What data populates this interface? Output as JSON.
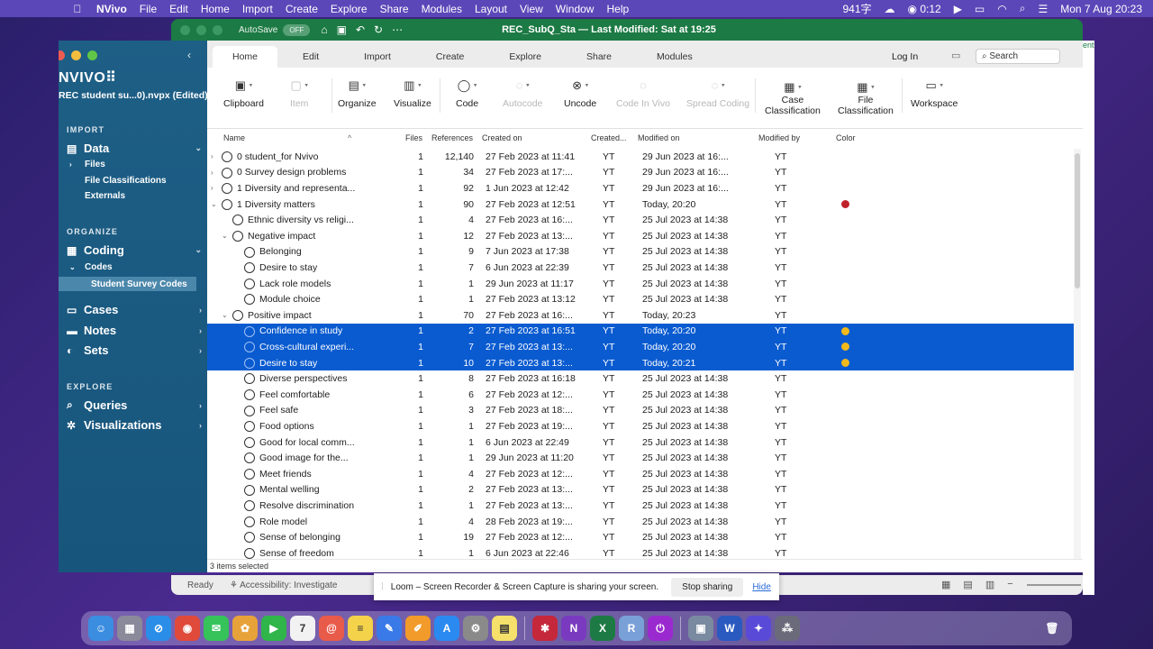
{
  "menubar": {
    "apple": "",
    "items": [
      "NVivo",
      "File",
      "Edit",
      "Home",
      "Import",
      "Create",
      "Explore",
      "Share",
      "Modules",
      "Layout",
      "View",
      "Window",
      "Help"
    ],
    "status_ime": "941字",
    "status_timer": "0:12",
    "datetime": "Mon 7 Aug  20:23"
  },
  "excel": {
    "autosave_label": "AutoSave",
    "autosave_state": "OFF",
    "title": "REC_SubQ_Sta — Last Modified: Sat at 19:25",
    "side_text": "ent",
    "status_ready": "Ready",
    "status_accessibility": "Accessibility: Investigate"
  },
  "sidebar": {
    "logo": "NVIVO",
    "logo_mark": "⠿",
    "project": "REC student su...0).nvpx (Edited)",
    "sections": {
      "import": "IMPORT",
      "organize": "ORGANIZE",
      "explore": "EXPLORE"
    },
    "data": "Data",
    "files": "Files",
    "file_classifications": "File Classifications",
    "externals": "Externals",
    "coding": "Coding",
    "codes": "Codes",
    "student_survey_codes": "Student Survey Codes",
    "cases": "Cases",
    "notes": "Notes",
    "sets": "Sets",
    "queries": "Queries",
    "visualizations": "Visualizations"
  },
  "tabs": {
    "home": "Home",
    "edit": "Edit",
    "import": "Import",
    "create": "Create",
    "explore": "Explore",
    "share": "Share",
    "modules": "Modules",
    "login": "Log In",
    "search_placeholder": "Search"
  },
  "ribbon": {
    "clipboard": "Clipboard",
    "item": "Item",
    "organize": "Organize",
    "visualize": "Visualize",
    "code": "Code",
    "autocode": "Autocode",
    "uncode": "Uncode",
    "code_in_vivo": "Code In Vivo",
    "spread_coding": "Spread Coding",
    "case_classification_1": "Case",
    "case_classification_2": "Classification",
    "file_classification_1": "File",
    "file_classification_2": "Classification",
    "workspace": "Workspace"
  },
  "columns": {
    "name": "Name",
    "files": "Files",
    "references": "References",
    "created_on": "Created on",
    "created_by": "Created...",
    "modified_on": "Modified on",
    "modified_by": "Modified by",
    "color": "Color"
  },
  "rows": [
    {
      "name": "0 student_for Nvivo",
      "files": "1",
      "refs": "12,140",
      "created": "27 Feb 2023 at 11:41",
      "by": "YT",
      "modified": "29 Jun 2023 at 16:...",
      "mby": "YT",
      "twisty": "›",
      "indent": 0,
      "color": "",
      "selected": false
    },
    {
      "name": "0 Survey design problems",
      "files": "1",
      "refs": "34",
      "created": "27 Feb 2023 at 17:...",
      "by": "YT",
      "modified": "29 Jun 2023 at 16:...",
      "mby": "YT",
      "twisty": "›",
      "indent": 0,
      "color": "",
      "selected": false
    },
    {
      "name": "1 Diversity and representa...",
      "files": "1",
      "refs": "92",
      "created": "1 Jun 2023 at 12:42",
      "by": "YT",
      "modified": "29 Jun 2023 at 16:...",
      "mby": "YT",
      "twisty": "›",
      "indent": 0,
      "color": "",
      "selected": false
    },
    {
      "name": "1 Diversity matters",
      "files": "1",
      "refs": "90",
      "created": "27 Feb 2023 at 12:51",
      "by": "YT",
      "modified": "Today, 20:20",
      "mby": "YT",
      "twisty": "⌄",
      "indent": 0,
      "color": "#c0202a",
      "selected": false
    },
    {
      "name": "Ethnic diversity vs religi...",
      "files": "1",
      "refs": "4",
      "created": "27 Feb 2023 at 16:...",
      "by": "YT",
      "modified": "25 Jul 2023 at 14:38",
      "mby": "YT",
      "twisty": "",
      "indent": 1,
      "color": "",
      "selected": false
    },
    {
      "name": "Negative impact",
      "files": "1",
      "refs": "12",
      "created": "27 Feb 2023 at 13:...",
      "by": "YT",
      "modified": "25 Jul 2023 at 14:38",
      "mby": "YT",
      "twisty": "⌄",
      "indent": 1,
      "color": "",
      "selected": false
    },
    {
      "name": "Belonging",
      "files": "1",
      "refs": "9",
      "created": "7 Jun 2023 at 17:38",
      "by": "YT",
      "modified": "25 Jul 2023 at 14:38",
      "mby": "YT",
      "twisty": "",
      "indent": 2,
      "color": "",
      "selected": false
    },
    {
      "name": "Desire to stay",
      "files": "1",
      "refs": "7",
      "created": "6 Jun 2023 at 22:39",
      "by": "YT",
      "modified": "25 Jul 2023 at 14:38",
      "mby": "YT",
      "twisty": "",
      "indent": 2,
      "color": "",
      "selected": false
    },
    {
      "name": "Lack role models",
      "files": "1",
      "refs": "1",
      "created": "29 Jun 2023 at 11:17",
      "by": "YT",
      "modified": "25 Jul 2023 at 14:38",
      "mby": "YT",
      "twisty": "",
      "indent": 2,
      "color": "",
      "selected": false
    },
    {
      "name": "Module choice",
      "files": "1",
      "refs": "1",
      "created": "27 Feb 2023 at 13:12",
      "by": "YT",
      "modified": "25 Jul 2023 at 14:38",
      "mby": "YT",
      "twisty": "",
      "indent": 2,
      "color": "",
      "selected": false
    },
    {
      "name": "Positive impact",
      "files": "1",
      "refs": "70",
      "created": "27 Feb 2023 at 16:...",
      "by": "YT",
      "modified": "Today, 20:23",
      "mby": "YT",
      "twisty": "⌄",
      "indent": 1,
      "color": "",
      "selected": false
    },
    {
      "name": "Confidence in study",
      "files": "1",
      "refs": "2",
      "created": "27 Feb 2023 at 16:51",
      "by": "YT",
      "modified": "Today, 20:20",
      "mby": "YT",
      "twisty": "",
      "indent": 2,
      "color": "#f2b91c",
      "selected": true
    },
    {
      "name": "Cross-cultural experi...",
      "files": "1",
      "refs": "7",
      "created": "27 Feb 2023 at 13:...",
      "by": "YT",
      "modified": "Today, 20:20",
      "mby": "YT",
      "twisty": "",
      "indent": 2,
      "color": "#f2b91c",
      "selected": true
    },
    {
      "name": "Desire to stay",
      "files": "1",
      "refs": "10",
      "created": "27 Feb 2023 at 13:...",
      "by": "YT",
      "modified": "Today, 20:21",
      "mby": "YT",
      "twisty": "",
      "indent": 2,
      "color": "#f2b91c",
      "selected": true
    },
    {
      "name": "Diverse perspectives",
      "files": "1",
      "refs": "8",
      "created": "27 Feb 2023 at 16:18",
      "by": "YT",
      "modified": "25 Jul 2023 at 14:38",
      "mby": "YT",
      "twisty": "",
      "indent": 2,
      "color": "",
      "selected": false
    },
    {
      "name": "Feel comfortable",
      "files": "1",
      "refs": "6",
      "created": "27 Feb 2023 at 12:...",
      "by": "YT",
      "modified": "25 Jul 2023 at 14:38",
      "mby": "YT",
      "twisty": "",
      "indent": 2,
      "color": "",
      "selected": false
    },
    {
      "name": "Feel safe",
      "files": "1",
      "refs": "3",
      "created": "27 Feb 2023 at 18:...",
      "by": "YT",
      "modified": "25 Jul 2023 at 14:38",
      "mby": "YT",
      "twisty": "",
      "indent": 2,
      "color": "",
      "selected": false
    },
    {
      "name": "Food options",
      "files": "1",
      "refs": "1",
      "created": "27 Feb 2023 at 19:...",
      "by": "YT",
      "modified": "25 Jul 2023 at 14:38",
      "mby": "YT",
      "twisty": "",
      "indent": 2,
      "color": "",
      "selected": false
    },
    {
      "name": "Good for local comm...",
      "files": "1",
      "refs": "1",
      "created": "6 Jun 2023 at 22:49",
      "by": "YT",
      "modified": "25 Jul 2023 at 14:38",
      "mby": "YT",
      "twisty": "",
      "indent": 2,
      "color": "",
      "selected": false
    },
    {
      "name": "Good image for the...",
      "files": "1",
      "refs": "1",
      "created": "29 Jun 2023 at 11:20",
      "by": "YT",
      "modified": "25 Jul 2023 at 14:38",
      "mby": "YT",
      "twisty": "",
      "indent": 2,
      "color": "",
      "selected": false
    },
    {
      "name": "Meet friends",
      "files": "1",
      "refs": "4",
      "created": "27 Feb 2023 at 12:...",
      "by": "YT",
      "modified": "25 Jul 2023 at 14:38",
      "mby": "YT",
      "twisty": "",
      "indent": 2,
      "color": "",
      "selected": false
    },
    {
      "name": "Mental welling",
      "files": "1",
      "refs": "2",
      "created": "27 Feb 2023 at 13:...",
      "by": "YT",
      "modified": "25 Jul 2023 at 14:38",
      "mby": "YT",
      "twisty": "",
      "indent": 2,
      "color": "",
      "selected": false
    },
    {
      "name": "Resolve discrimination",
      "files": "1",
      "refs": "1",
      "created": "27 Feb 2023 at 13:...",
      "by": "YT",
      "modified": "25 Jul 2023 at 14:38",
      "mby": "YT",
      "twisty": "",
      "indent": 2,
      "color": "",
      "selected": false
    },
    {
      "name": "Role model",
      "files": "1",
      "refs": "4",
      "created": "28 Feb 2023 at 19:...",
      "by": "YT",
      "modified": "25 Jul 2023 at 14:38",
      "mby": "YT",
      "twisty": "",
      "indent": 2,
      "color": "",
      "selected": false
    },
    {
      "name": "Sense of belonging",
      "files": "1",
      "refs": "19",
      "created": "27 Feb 2023 at 12:...",
      "by": "YT",
      "modified": "25 Jul 2023 at 14:38",
      "mby": "YT",
      "twisty": "",
      "indent": 2,
      "color": "",
      "selected": false
    },
    {
      "name": "Sense of freedom",
      "files": "1",
      "refs": "1",
      "created": "6 Jun 2023 at 22:46",
      "by": "YT",
      "modified": "25 Jul 2023 at 14:38",
      "mby": "YT",
      "twisty": "",
      "indent": 2,
      "color": "",
      "selected": false
    }
  ],
  "status": "3 items selected",
  "loom": {
    "message": "Loom – Screen Recorder & Screen Capture is sharing your screen.",
    "stop": "Stop sharing",
    "hide": "Hide"
  },
  "dock": {
    "apps": [
      {
        "name": "finder",
        "color": "#3b8de0",
        "glyph": "☺"
      },
      {
        "name": "launchpad",
        "color": "#8a8a9a",
        "glyph": "▦"
      },
      {
        "name": "safari",
        "color": "#2a8ee8",
        "glyph": "⊘"
      },
      {
        "name": "chrome",
        "color": "#e04a3a",
        "glyph": "◉"
      },
      {
        "name": "messages",
        "color": "#35c35a",
        "glyph": "✉"
      },
      {
        "name": "photos",
        "color": "#e8a23a",
        "glyph": "✿"
      },
      {
        "name": "facetime",
        "color": "#2fb54a",
        "glyph": "▶"
      },
      {
        "name": "calendar",
        "color": "#f2f2f2",
        "glyph": "7"
      },
      {
        "name": "mail",
        "color": "#e85a4a",
        "glyph": "@"
      },
      {
        "name": "notes",
        "color": "#f4d24a",
        "glyph": "≡"
      },
      {
        "name": "freeform",
        "color": "#3a7ae8",
        "glyph": "✎"
      },
      {
        "name": "pages",
        "color": "#f29a2a",
        "glyph": "✐"
      },
      {
        "name": "app-store",
        "color": "#2a8af0",
        "glyph": "A"
      },
      {
        "name": "system-settings",
        "color": "#8a8a8a",
        "glyph": "⚙"
      },
      {
        "name": "stickies",
        "color": "#f4e06a",
        "glyph": "▤"
      },
      {
        "name": "nvivo",
        "color": "#c4283a",
        "glyph": "✱"
      },
      {
        "name": "onenote",
        "color": "#7a3ac0",
        "glyph": "N"
      },
      {
        "name": "excel",
        "color": "#1e7a44",
        "glyph": "X"
      },
      {
        "name": "rstudio",
        "color": "#7aa0d8",
        "glyph": "R"
      },
      {
        "name": "screen-timer",
        "color": "#9a2ad0",
        "glyph": "⏻"
      },
      {
        "name": "preview",
        "color": "#7a8aa0",
        "glyph": "▣"
      },
      {
        "name": "word",
        "color": "#2a5ac0",
        "glyph": "W"
      },
      {
        "name": "loom",
        "color": "#5a4ad8",
        "glyph": "✦"
      },
      {
        "name": "zoom-app",
        "color": "#6a6a7a",
        "glyph": "⁂"
      }
    ],
    "trash_glyph": "🗑"
  }
}
